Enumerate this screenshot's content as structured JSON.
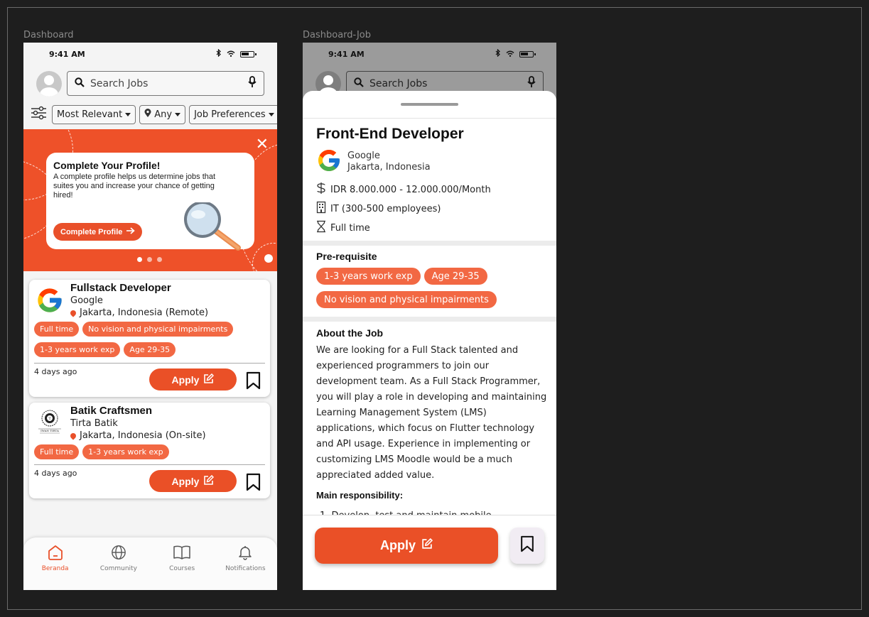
{
  "frames": {
    "dashboard_label": "Dashboard",
    "detail_label": "Dashboard-Job"
  },
  "status_bar": {
    "time": "9:41 AM"
  },
  "search": {
    "placeholder": "Search Jobs"
  },
  "filters": [
    {
      "label": "Most Relevant"
    },
    {
      "label": "Any"
    },
    {
      "label": "Job Preferences"
    }
  ],
  "banner": {
    "title": "Complete Your Profile!",
    "text": "A complete profile helps us determine jobs that suites you and increase your chance of getting hired!",
    "button": "Complete Profile"
  },
  "jobs": [
    {
      "title": "Fullstack Developer",
      "company": "Google",
      "location": "Jakarta, Indonesia (Remote)",
      "tags_row1": [
        "Full time",
        "No vision and physical impairments"
      ],
      "tags_row2": [
        "1-3 years work exp",
        "Age 29-35"
      ],
      "posted": "4 days ago",
      "apply": "Apply"
    },
    {
      "title": "Batik Craftsmen",
      "company": "Tirta Batik",
      "location": "Jakarta, Indonesia (On-site)",
      "tags_row1": [
        "Full time",
        "1-3 years work exp"
      ],
      "posted": "4 days ago",
      "apply": "Apply",
      "logo_text": "IWAN TIRTA"
    }
  ],
  "nav": [
    {
      "label": "Beranda",
      "icon": "home-icon",
      "active": true
    },
    {
      "label": "Community",
      "icon": "globe-icon"
    },
    {
      "label": "Courses",
      "icon": "book-icon"
    },
    {
      "label": "Notifications",
      "icon": "bell-icon"
    }
  ],
  "detail": {
    "title": "Front-End Developer",
    "company": "Google",
    "location": "Jakarta, Indonesia",
    "salary": "IDR 8.000.000 - 12.000.000/Month",
    "industry": "IT (300-500 employees)",
    "type": "Full time",
    "prereq_title": "Pre-requisite",
    "prereq_tags_row1": [
      "1-3 years work exp",
      "Age 29-35"
    ],
    "prereq_tags_row2": [
      "No vision and physical impairments"
    ],
    "about_title": "About the Job",
    "about_text": "We are looking for a Full Stack talented and experienced programmers to join our development team. As a Full Stack Programmer, you will play a role in developing and maintaining Learning Management System (LMS) applications, which focus on Flutter technology and API usage. Experience in implementing or customizing LMS Moodle would be a much appreciated added value.",
    "responsibility_title": "Main responsibility:",
    "responsibility_peek": "1. Develop, test and maintain mobile",
    "apply": "Apply"
  },
  "colors": {
    "accent": "#ea5027",
    "tag": "#f26843",
    "background": "#1e1e1e"
  }
}
